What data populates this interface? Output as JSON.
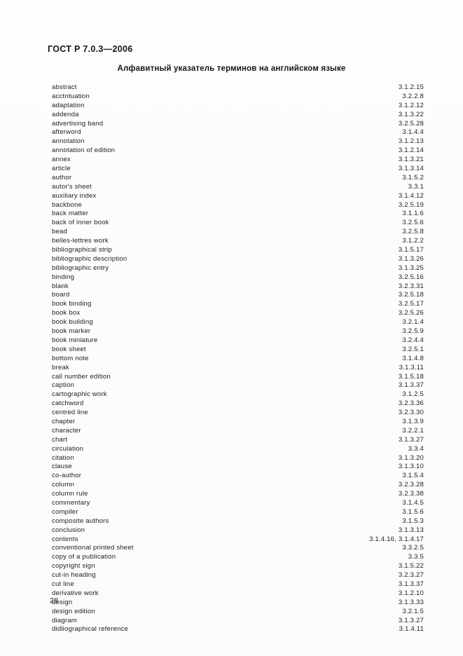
{
  "document": {
    "standard_header": "ГОСТ Р 7.0.3—2006",
    "title": "Алфавитный указатель терминов на английском языке",
    "page_number": "28"
  },
  "index": {
    "entries": [
      {
        "term": "abstract",
        "ref": "3.1.2.15"
      },
      {
        "term": "acctntuation",
        "ref": "3.2.2.8"
      },
      {
        "term": "adaptation",
        "ref": "3.1.2.12"
      },
      {
        "term": "addenda",
        "ref": "3.1.3.22"
      },
      {
        "term": "advertising band",
        "ref": "3.2.5.28"
      },
      {
        "term": "afterword",
        "ref": "3.1.4.4"
      },
      {
        "term": "annotation",
        "ref": "3.1.2.13"
      },
      {
        "term": "annotation of edition",
        "ref": "3.1.2.14"
      },
      {
        "term": "annex",
        "ref": "3.1.3.21"
      },
      {
        "term": "article",
        "ref": "3.1.3.14"
      },
      {
        "term": "author",
        "ref": "3.1.5.2"
      },
      {
        "term": "autor's sheet",
        "ref": "3.3.1"
      },
      {
        "term": "auxiliary index",
        "ref": "3.1.4.12"
      },
      {
        "term": "backbone",
        "ref": "3.2.5.19"
      },
      {
        "term": "back matter",
        "ref": "3.1.1.6"
      },
      {
        "term": "back of inner book",
        "ref": "3.2.5.6"
      },
      {
        "term": "bead",
        "ref": "3.2.5.8"
      },
      {
        "term": "belles-lettres work",
        "ref": "3.1.2.2"
      },
      {
        "term": "bibliographical strip",
        "ref": "3.1.5.17"
      },
      {
        "term": "bibliographic description",
        "ref": "3.1.3.26"
      },
      {
        "term": "bibliographic entry",
        "ref": "3.1.3.25"
      },
      {
        "term": "binding",
        "ref": "3.2.5.16"
      },
      {
        "term": "blank",
        "ref": "3.2.3.31"
      },
      {
        "term": "board",
        "ref": "3.2.5.18"
      },
      {
        "term": "book binding",
        "ref": "3.2.5.17"
      },
      {
        "term": "book box",
        "ref": "3.2.5.26"
      },
      {
        "term": "book building",
        "ref": "3.2.1.4"
      },
      {
        "term": "book marker",
        "ref": "3.2.5.9"
      },
      {
        "term": "book miniature",
        "ref": "3.2.4.4"
      },
      {
        "term": "book sheet",
        "ref": "3.2.5.1"
      },
      {
        "term": "bottom note",
        "ref": "3.1.4.8"
      },
      {
        "term": "break",
        "ref": "3.1.3.11"
      },
      {
        "term": "call number edition",
        "ref": "3.1.5.18"
      },
      {
        "term": "caption",
        "ref": "3.1.3.37"
      },
      {
        "term": "cartographic work",
        "ref": "3.1.2.5"
      },
      {
        "term": "catchword",
        "ref": "3.2.3.36"
      },
      {
        "term": "centred line",
        "ref": "3.2.3.30"
      },
      {
        "term": "chapter",
        "ref": "3.1.3.9"
      },
      {
        "term": "character",
        "ref": "3.2.2.1"
      },
      {
        "term": "chart",
        "ref": "3.1.3.27"
      },
      {
        "term": "circulation",
        "ref": "3.3.4"
      },
      {
        "term": "citation",
        "ref": "3.1.3.20"
      },
      {
        "term": "clause",
        "ref": "3.1.3.10"
      },
      {
        "term": "co-author",
        "ref": "3.1.5.4"
      },
      {
        "term": "column",
        "ref": "3.2.3.28"
      },
      {
        "term": "column rule",
        "ref": "3.2.3.38"
      },
      {
        "term": "commentary",
        "ref": "3.1.4.5"
      },
      {
        "term": "compiler",
        "ref": "3.1.5.6"
      },
      {
        "term": "composite authors",
        "ref": "3.1.5.3"
      },
      {
        "term": "conclusion",
        "ref": "3.1.3.13"
      },
      {
        "term": "contents",
        "ref": "3.1.4.16, 3.1.4.17"
      },
      {
        "term": "conventional printed sheet",
        "ref": "3.3.2.5"
      },
      {
        "term": "copy of a publication",
        "ref": "3.3.5"
      },
      {
        "term": "copyright sign",
        "ref": "3.1.5.22"
      },
      {
        "term": "cut-in heading",
        "ref": "3.2.3.27"
      },
      {
        "term": "cut line",
        "ref": "3.1.3.37"
      },
      {
        "term": "derivative work",
        "ref": "3.1.2.10"
      },
      {
        "term": "design",
        "ref": "3.1.3.33"
      },
      {
        "term": "design edition",
        "ref": "3.2.1.5"
      },
      {
        "term": "diagram",
        "ref": "3.1.3.27"
      },
      {
        "term": "didliographical reference",
        "ref": "3.1.4.11"
      }
    ]
  }
}
